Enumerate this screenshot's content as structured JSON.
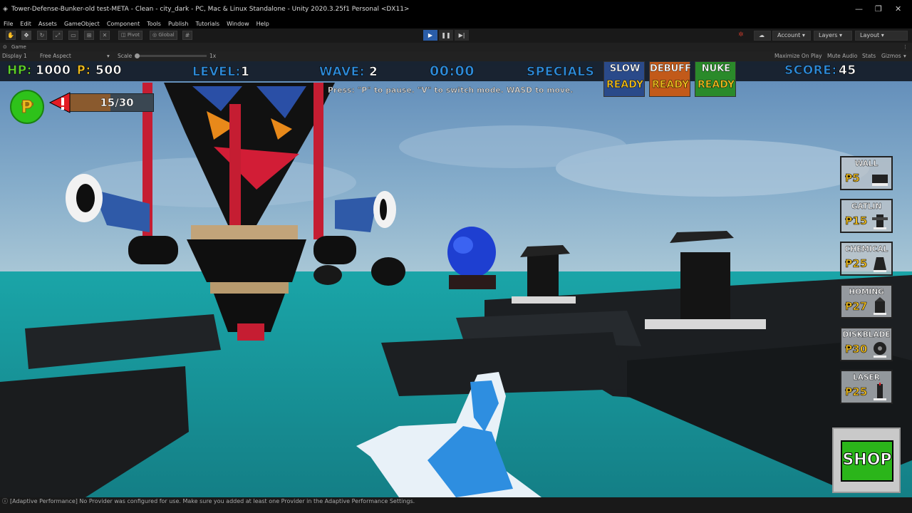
{
  "window": {
    "title": "Tower-Defense-Bunker-old test-META - Clean - city_dark - PC, Mac & Linux Standalone - Unity 2020.3.25f1 Personal <DX11>",
    "minimize_icon": "minimize-icon",
    "maximize_icon": "maximize-icon",
    "close_icon": "close-icon"
  },
  "menu": [
    "File",
    "Edit",
    "Assets",
    "GameObject",
    "Component",
    "Tools",
    "Publish",
    "Tutorials",
    "Window",
    "Help"
  ],
  "toolbar": {
    "pivot_label": "Pivot",
    "global_label": "Global",
    "account_label": "Account",
    "layers_label": "Layers",
    "layout_label": "Layout",
    "play_active": true
  },
  "game_tab": {
    "label": "Game"
  },
  "game_toolbar": {
    "display": "Display 1",
    "aspect": "Free Aspect",
    "scale_label": "Scale",
    "scale_value": "1x",
    "maximize_on_play": "Maximize On Play",
    "mute_audio": "Mute Audio",
    "stats": "Stats",
    "gizmos": "Gizmos"
  },
  "hud": {
    "hp_label": "HP:",
    "hp_value": "1000",
    "money_label": "₱:",
    "money_value": "500",
    "level_label": "LEVEL:",
    "level_value": "1",
    "wave_label": "WAVE:",
    "wave_value": "2",
    "timer": "00:00",
    "specials_label": "SPECIALS",
    "score_label": "SCORE:",
    "score_value": "45",
    "hint": "Press: \"P\" to pause. \"V\" to switch mode. WASD to move.",
    "enemy_progress": "15/30",
    "enemy_progress_fraction": 0.5,
    "coin_symbol": "₱"
  },
  "specials": [
    {
      "name": "SLOW",
      "status": "READY",
      "color": "#2a4a8a"
    },
    {
      "name": "DEBUFF",
      "status": "READY",
      "color": "#c25a1a"
    },
    {
      "name": "NUKE",
      "status": "READY",
      "color": "#2a8a2a"
    }
  ],
  "towers": [
    {
      "name": "WALL",
      "price": "₱5"
    },
    {
      "name": "GATLIN",
      "price": "₱15"
    },
    {
      "name": "CHEMICAL",
      "price": "₱25"
    },
    {
      "name": "HOMING",
      "price": "₱27"
    },
    {
      "name": "DISKBLADE",
      "price": "₱30"
    },
    {
      "name": "LASER",
      "price": "₱25"
    }
  ],
  "shop": {
    "label": "SHOP"
  },
  "status_bar": {
    "message": "[Adaptive Performance] No Provider was configured for use. Make sure you added at least one Provider in the Adaptive Performance Settings."
  }
}
